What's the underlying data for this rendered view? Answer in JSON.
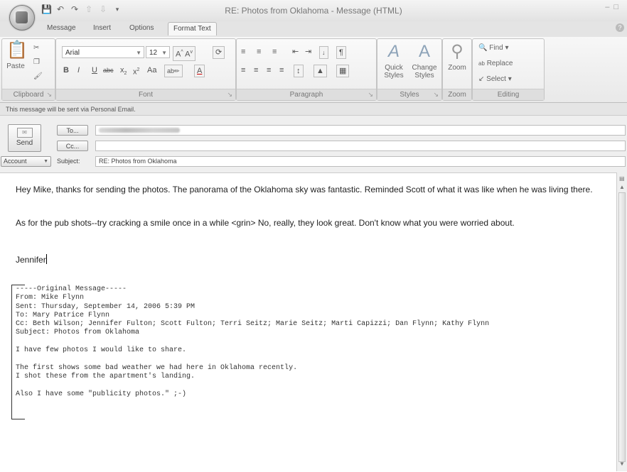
{
  "window": {
    "title": "RE: Photos from Oklahoma - Message (HTML)"
  },
  "quick_access": {
    "icons": [
      "save-icon",
      "undo-icon",
      "redo-icon",
      "up-icon",
      "down-icon",
      "customize-icon"
    ]
  },
  "tabs": [
    {
      "label": "Message"
    },
    {
      "label": "Insert"
    },
    {
      "label": "Options"
    },
    {
      "label": "Format Text",
      "active": true
    }
  ],
  "ribbon": {
    "clipboard": {
      "paste": "Paste",
      "label": "Clipboard"
    },
    "font": {
      "name": "Arial",
      "size": "12",
      "label": "Font"
    },
    "paragraph": {
      "label": "Paragraph"
    },
    "styles": {
      "quick": "Quick Styles",
      "change": "Change Styles",
      "label": "Styles"
    },
    "zoom": {
      "button": "Zoom",
      "label": "Zoom"
    },
    "editing": {
      "find": "Find",
      "replace": "Replace",
      "select": "Select",
      "label": "Editing"
    }
  },
  "info_bar": "This message will be sent via Personal Email.",
  "header": {
    "send": "Send",
    "to_button": "To...",
    "cc_button": "Cc...",
    "account_button": "Account",
    "subject_label": "Subject:",
    "subject_value": "RE: Photos from Oklahoma"
  },
  "message": {
    "p1": "Hey Mike, thanks for sending the photos. The panorama of the Oklahoma sky was fantastic. Reminded Scott of what it was like when he was living there.",
    "p2": "As for the pub shots--try cracking a smile once in a while <grin> No, really, they look great. Don't know what you were worried about.",
    "signature": "Jennifer"
  },
  "original": [
    "-----Original Message-----",
    "From: Mike Flynn",
    "Sent: Thursday, September 14, 2006 5:39 PM",
    "To: Mary Patrice Flynn",
    "Cc: Beth Wilson; Jennifer Fulton; Scott Fulton; Terri Seitz; Marie Seitz; Marti Capizzi; Dan Flynn; Kathy Flynn",
    "Subject: Photos from Oklahoma",
    "",
    "I have few photos I would like to share.",
    "",
    "The first shows some bad weather we had here in Oklahoma recently.",
    "I shot these from the apartment's landing.",
    "",
    "Also I have some \"publicity photos.\" ;-)"
  ]
}
